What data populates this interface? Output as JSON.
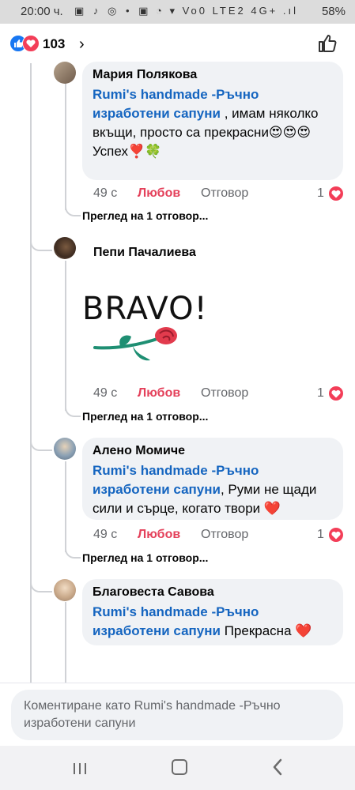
{
  "status_bar": {
    "time": "20:00 ч.",
    "left_icons": "▣ ♪ ◎ •",
    "right_icons": "▣ ◔ ▾ Vo0 LTE2 4G+ .ıl",
    "battery": "58%"
  },
  "header": {
    "reaction_count": "103",
    "chevron": "›",
    "icons": [
      "like-reaction-icon",
      "love-reaction-icon",
      "thumbs-up-outline-icon"
    ]
  },
  "comments": [
    {
      "author": "Мария Полякова",
      "mention": "Rumi's handmade -Ръчно изработени сапуни",
      "text": " , имам няколко вкъщи, просто са прекрасни😍😍😍",
      "text2": "Успех❣️🍀",
      "time": "49 с",
      "love_label": "Любов",
      "reply_label": "Отговор",
      "reaction_count": "1",
      "view_replies": "Преглед на 1 отговор..."
    },
    {
      "author": "Пепи Пачалиева",
      "sticker_text": "BRAVO!",
      "time": "49 с",
      "love_label": "Любов",
      "reply_label": "Отговор",
      "reaction_count": "1",
      "view_replies": "Преглед на 1 отговор..."
    },
    {
      "author": "Алено Момиче",
      "mention": "Rumi's handmade -Ръчно изработени сапуни",
      "text": ", Руми не щади сили и сърце, когато твори ❤️",
      "time": "49 с",
      "love_label": "Любов",
      "reply_label": "Отговор",
      "reaction_count": "1",
      "view_replies": "Преглед на 1 отговор..."
    },
    {
      "author": "Благовеста Савова",
      "mention": "Rumi's handmade -Ръчно изработени сапуни",
      "text": " Прекрасна ❤️"
    }
  ],
  "composer": {
    "placeholder": "Коментиране като Rumi's handmade -Ръчно изработени сапуни"
  },
  "colors": {
    "mention": "#1565c0",
    "love": "#e4415b",
    "like_blue": "#1877f2",
    "bubble": "#f0f2f5"
  }
}
